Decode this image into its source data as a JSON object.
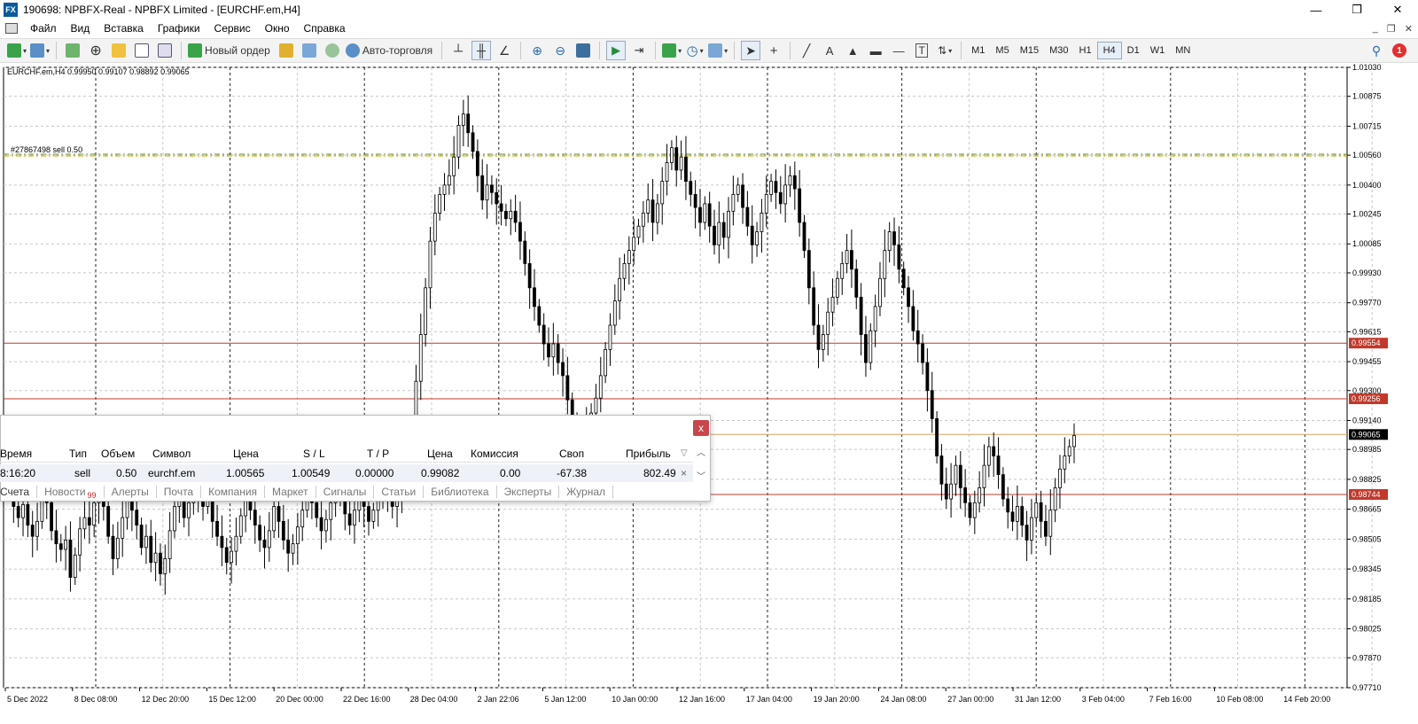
{
  "window": {
    "title": "190698: NPBFX-Real - NPBFX Limited - [EURCHF.em,H4]",
    "app_icon_text": "FX",
    "controls": [
      "—",
      "❐",
      "✕"
    ]
  },
  "menu": {
    "items": [
      "Файл",
      "Вид",
      "Вставка",
      "Графики",
      "Сервис",
      "Окно",
      "Справка"
    ],
    "mdi_controls": [
      "_",
      "❐",
      "✕"
    ]
  },
  "toolbar": {
    "new_order_label": "Новый ордер",
    "autotrade_label": "Авто-торговля",
    "timeframes": [
      "M1",
      "M5",
      "M15",
      "M30",
      "H1",
      "H4",
      "D1",
      "W1",
      "MN"
    ],
    "active_timeframe": "H4",
    "notification_count": "1"
  },
  "chart_data": {
    "type": "candlestick",
    "symbol_header": "EURCHF.em,H4  0.99950 0.99107 0.98892 0.99065",
    "price_axis_ticks": [
      "1.01030",
      "1.00875",
      "1.00715",
      "1.00560",
      "1.00400",
      "1.00245",
      "1.00085",
      "0.99930",
      "0.99770",
      "0.99615",
      "0.99455",
      "0.99300",
      "0.99140",
      "0.98985",
      "0.98825",
      "0.98665",
      "0.98505",
      "0.98345",
      "0.98185",
      "0.98025",
      "0.97870",
      "0.97710"
    ],
    "ylim": [
      0.9771,
      1.0103
    ],
    "time_axis_ticks": [
      "5 Dec 2022",
      "8 Dec 08:00",
      "12 Dec 20:00",
      "15 Dec 12:00",
      "20 Dec 00:00",
      "22 Dec 16:00",
      "28 Dec 04:00",
      "2 Jan 22:06",
      "5 Jan 12:00",
      "10 Jan 00:00",
      "12 Jan 16:00",
      "17 Jan 04:00",
      "19 Jan 20:00",
      "24 Jan 08:00",
      "27 Jan 00:00",
      "31 Jan 12:00",
      "3 Feb 04:00",
      "7 Feb 16:00",
      "10 Feb 08:00",
      "14 Feb 20:00"
    ],
    "order_line_label": "#27867498 sell 0.50",
    "order_line_price": 1.00565,
    "horizontal_levels": [
      {
        "price": 0.99554,
        "label": "0.99554",
        "color": "#c0392b"
      },
      {
        "price": 0.99256,
        "label": "0.99256",
        "color": "#c0392b"
      },
      {
        "price": 0.99065,
        "label": "0.99065",
        "color": "#000000"
      },
      {
        "price": 0.98744,
        "label": "0.98744",
        "color": "#c0392b"
      }
    ],
    "current_price": 0.99065,
    "grid": true,
    "closes": [
      0.9875,
      0.9868,
      0.9862,
      0.9869,
      0.9858,
      0.9852,
      0.986,
      0.9872,
      0.987,
      0.9855,
      0.9848,
      0.9845,
      0.985,
      0.983,
      0.9842,
      0.9856,
      0.9862,
      0.9858,
      0.987,
      0.9875,
      0.9868,
      0.9852,
      0.984,
      0.9851,
      0.9862,
      0.9871,
      0.9866,
      0.9858,
      0.9846,
      0.9852,
      0.9838,
      0.9843,
      0.9832,
      0.984,
      0.9855,
      0.9868,
      0.9874,
      0.9862,
      0.987,
      0.9881,
      0.9876,
      0.9868,
      0.9871,
      0.986,
      0.9852,
      0.9846,
      0.9838,
      0.9844,
      0.9852,
      0.9863,
      0.9872,
      0.9866,
      0.9858,
      0.985,
      0.9846,
      0.9855,
      0.9868,
      0.986,
      0.985,
      0.9843,
      0.9848,
      0.9857,
      0.9866,
      0.9876,
      0.987,
      0.9862,
      0.9855,
      0.9861,
      0.987,
      0.9877,
      0.9872,
      0.9864,
      0.9858,
      0.9866,
      0.9875,
      0.9868,
      0.986,
      0.9866,
      0.9872,
      0.988,
      0.9875,
      0.9868,
      0.9872,
      0.988,
      0.9892,
      0.991,
      0.9935,
      0.996,
      0.9985,
      1.001,
      1.0025,
      1.0035,
      1.004,
      1.0045,
      1.0055,
      1.0072,
      1.0078,
      1.0068,
      1.0058,
      1.0045,
      1.0032,
      1.004,
      1.0036,
      1.003,
      1.0026,
      1.0022,
      1.0026,
      1.002,
      1.001,
      0.9998,
      0.9985,
      0.9975,
      0.9965,
      0.9955,
      0.9948,
      0.9955,
      0.9945,
      0.9938,
      0.9925,
      0.9912,
      0.9905,
      0.9898,
      0.991,
      0.9918,
      0.9926,
      0.9938,
      0.9952,
      0.9965,
      0.9978,
      0.999,
      0.9998,
      1.0005,
      1.0012,
      1.0018,
      1.0025,
      1.0032,
      1.002,
      1.003,
      1.0042,
      1.0052,
      1.006,
      1.0048,
      1.0055,
      1.0042,
      1.0035,
      1.0028,
      1.002,
      1.003,
      1.0018,
      1.0008,
      1.002,
      1.0012,
      1.0026,
      1.0035,
      1.004,
      1.0028,
      1.0018,
      1.0008,
      1.0015,
      1.0025,
      1.0035,
      1.0042,
      1.0036,
      1.003,
      1.004,
      1.0045,
      1.0038,
      1.002,
      1.0005,
      0.9985,
      0.9965,
      0.9952,
      0.996,
      0.9972,
      0.998,
      0.999,
      0.9998,
      1.0005,
      0.9995,
      0.998,
      0.996,
      0.9945,
      0.9962,
      0.9975,
      0.999,
      1.0005,
      1.0015,
      1.0008,
      0.9995,
      0.9985,
      0.9975,
      0.9962,
      0.9955,
      0.9945,
      0.993,
      0.9915,
      0.9895,
      0.988,
      0.9872,
      0.988,
      0.989,
      0.9878,
      0.987,
      0.9862,
      0.987,
      0.9878,
      0.989,
      0.99,
      0.9895,
      0.9885,
      0.9872,
      0.9865,
      0.986,
      0.9868,
      0.9858,
      0.985,
      0.9862,
      0.987,
      0.986,
      0.9852,
      0.9866,
      0.9878,
      0.9888,
      0.9895,
      0.99,
      0.9906
    ]
  },
  "terminal": {
    "close_label": "x",
    "columns": [
      "Время",
      "Тип",
      "Объем",
      "Символ",
      "Цена",
      "S / L",
      "T / P",
      "Цена",
      "Комиссия",
      "Своп",
      "Прибыль"
    ],
    "row": [
      "8:16:20",
      "sell",
      "0.50",
      "eurchf.em",
      "1.00565",
      "1.00549",
      "0.00000",
      "0.99082",
      "0.00",
      "-67.38",
      "802.49"
    ],
    "tabs": [
      "Счета",
      "Новости",
      "Алерты",
      "Почта",
      "Компания",
      "Маркет",
      "Сигналы",
      "Статьи",
      "Библиотека",
      "Эксперты",
      "Журнал"
    ],
    "news_badge": "99",
    "row_close": "×"
  }
}
